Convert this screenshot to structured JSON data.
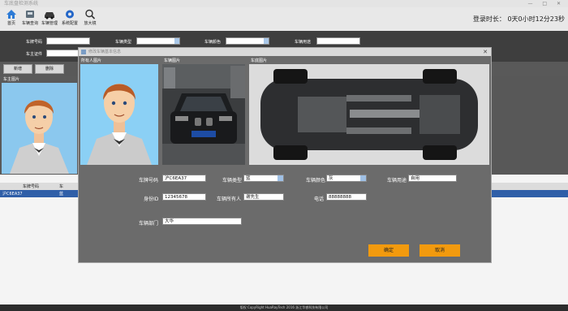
{
  "window": {
    "title": "车底盘检测系统",
    "controls": "— □ ✕"
  },
  "toolbar": {
    "items": [
      {
        "label": "首页",
        "icon": "home-icon"
      },
      {
        "label": "车辆查询",
        "icon": "car-search-icon"
      },
      {
        "label": "车辆管理",
        "icon": "car-manage-icon"
      },
      {
        "label": "系统配置",
        "icon": "gear-icon"
      },
      {
        "label": "放大镜",
        "icon": "magnifier-icon"
      }
    ],
    "login_label": "登录时长：",
    "login_value": "0天0小时12分23秒"
  },
  "filters": {
    "plate_label": "车牌号码",
    "type_label": "车辆类型",
    "color_label": "车辆颜色",
    "usage_label": "车辆用途",
    "pass_label": "车主证件"
  },
  "actions": {
    "add": "新增",
    "delete": "删除"
  },
  "left_panel": {
    "header": "车主图片"
  },
  "list": {
    "col_plate": "车牌号码",
    "col_dept": "车",
    "row_plate": "沪C6EA37",
    "row_type": "蓝"
  },
  "dialog": {
    "title": "修改车辆基本信息",
    "owner_photo_label": "所有人图片",
    "car_photo_label": "车辆图片",
    "chassis_photo_label": "车底图片",
    "plate_number": "沪C6EA37",
    "fields": {
      "plate_label": "车牌号码",
      "plate_value": "沪C6EA37",
      "type_label": "车辆类型",
      "type_value": "蓝",
      "color_label": "车辆颜色",
      "color_value": "灰",
      "usage_label": "车辆用途",
      "usage_value": "自用",
      "id_label": "身份ID",
      "id_value": "12345678",
      "owner_label": "车辆所有人",
      "owner_value": "谢先生",
      "phone_label": "电话",
      "phone_value": "88888888",
      "dept_label": "车辆部门",
      "dept_value": "大华"
    },
    "ok": "确定",
    "cancel": "取消"
  },
  "footer": "版权 CopyRight HuaRayTech 2016 浙江华睿科技有限公司"
}
